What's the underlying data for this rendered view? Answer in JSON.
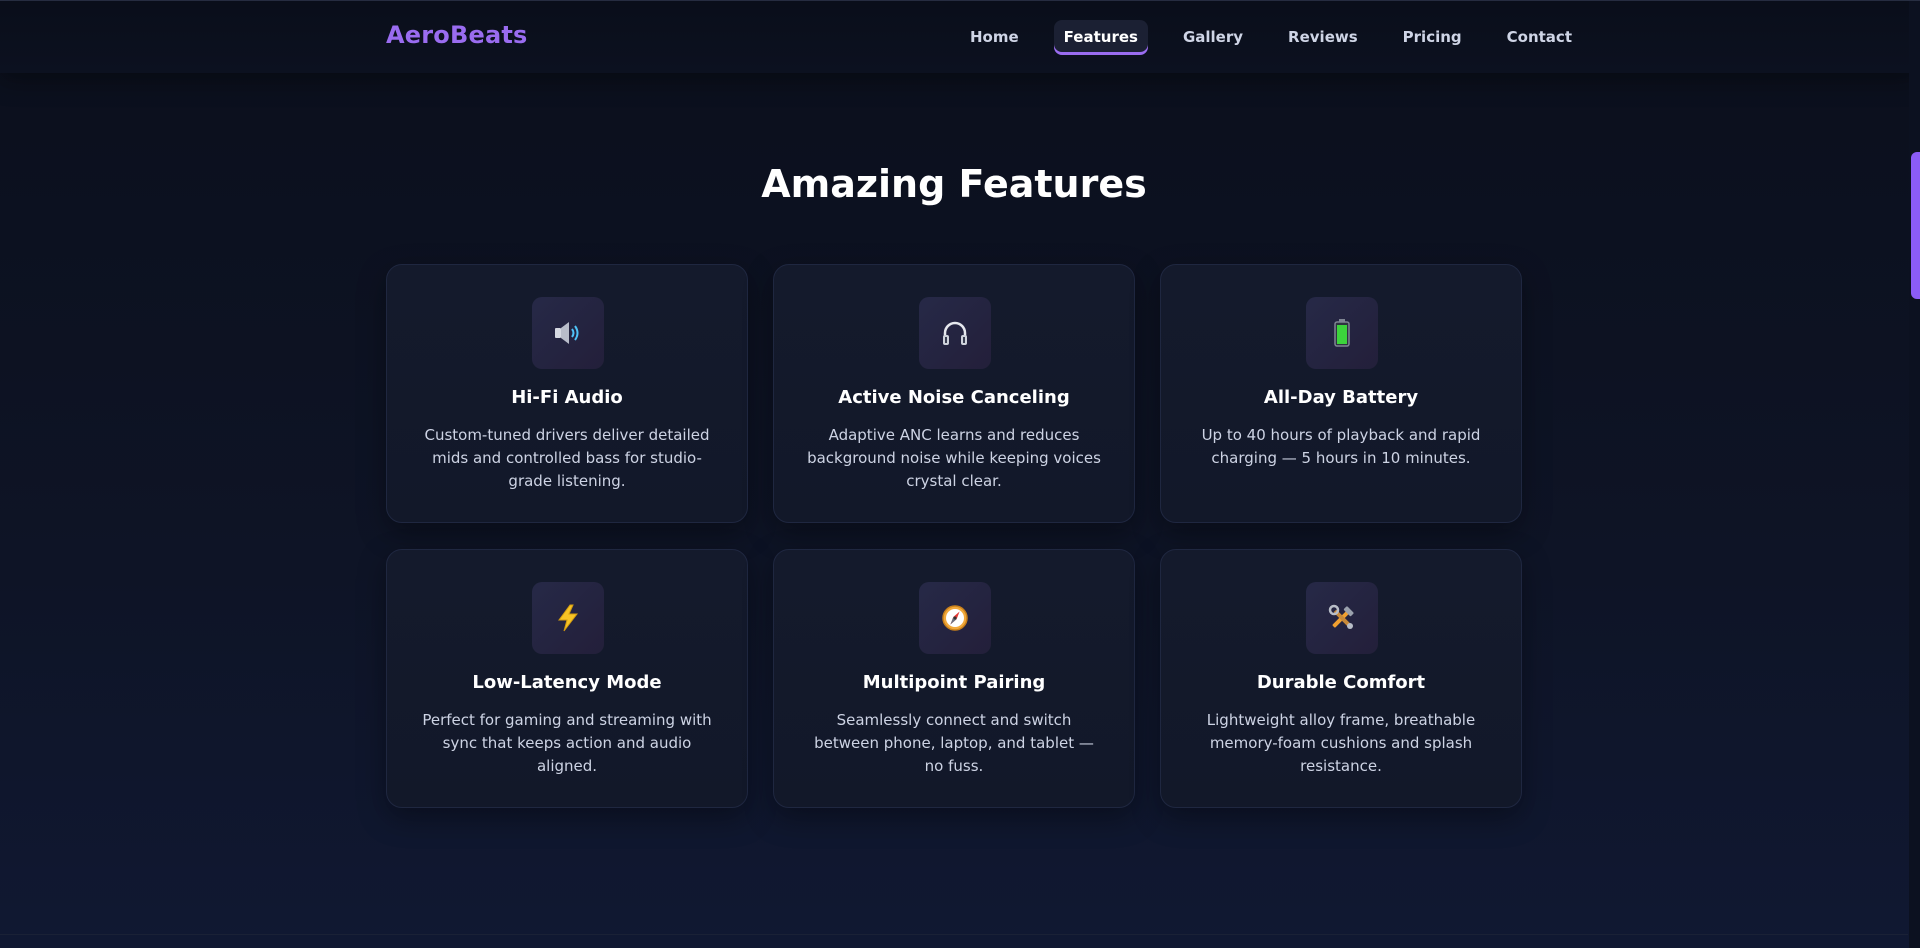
{
  "brand": {
    "name": "AeroBeats",
    "color": "#9a6cf0"
  },
  "nav": {
    "items": [
      {
        "label": "Home",
        "active": false
      },
      {
        "label": "Features",
        "active": true
      },
      {
        "label": "Gallery",
        "active": false
      },
      {
        "label": "Reviews",
        "active": false
      },
      {
        "label": "Pricing",
        "active": false
      },
      {
        "label": "Contact",
        "active": false
      }
    ]
  },
  "section": {
    "title": "Amazing Features"
  },
  "features": [
    {
      "icon": "speaker-icon",
      "title": "Hi-Fi Audio",
      "description": "Custom-tuned drivers deliver detailed mids and controlled bass for studio-grade listening."
    },
    {
      "icon": "headphones-icon",
      "title": "Active Noise Canceling",
      "description": "Adaptive ANC learns and reduces background noise while keeping voices crystal clear."
    },
    {
      "icon": "battery-icon",
      "title": "All-Day Battery",
      "description": "Up to 40 hours of playback and rapid charging — 5 hours in 10 minutes."
    },
    {
      "icon": "lightning-icon",
      "title": "Low-Latency Mode",
      "description": "Perfect for gaming and streaming with sync that keeps action and audio aligned."
    },
    {
      "icon": "compass-icon",
      "title": "Multipoint Pairing",
      "description": "Seamlessly connect and switch between phone, laptop, and tablet — no fuss."
    },
    {
      "icon": "tools-icon",
      "title": "Durable Comfort",
      "description": "Lightweight alloy frame, breathable memory-foam cushions and splash resistance."
    }
  ],
  "colors": {
    "accent": "#9a6cf0",
    "background": "#0e1426",
    "card": "#141a2c"
  }
}
